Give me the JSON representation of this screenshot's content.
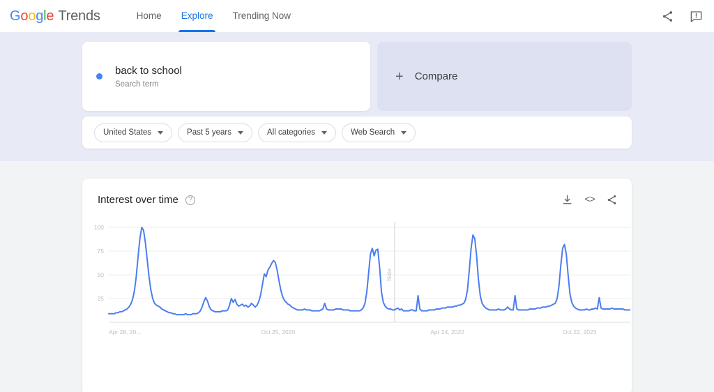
{
  "header": {
    "logo": {
      "text": "Google",
      "suffix": "Trends"
    },
    "nav": [
      {
        "label": "Home",
        "active": false
      },
      {
        "label": "Explore",
        "active": true
      },
      {
        "label": "Trending Now",
        "active": false
      }
    ],
    "actions": [
      {
        "name": "share-icon"
      },
      {
        "name": "feedback-icon"
      }
    ]
  },
  "query": {
    "term": "back to school",
    "type": "Search term",
    "dot_color": "#4285F4",
    "compare_label": "Compare",
    "compare_plus": "+"
  },
  "filters": [
    {
      "label": "United States",
      "name": "location"
    },
    {
      "label": "Past 5 years",
      "name": "time-range"
    },
    {
      "label": "All categories",
      "name": "category"
    },
    {
      "label": "Web Search",
      "name": "search-type"
    }
  ],
  "chart_card": {
    "title": "Interest over time",
    "help_glyph": "?",
    "tools": [
      {
        "name": "download-icon"
      },
      {
        "name": "embed-icon",
        "glyph": "<>"
      },
      {
        "name": "share-icon"
      }
    ]
  },
  "chart_data": {
    "type": "line",
    "title": "Interest over time",
    "xlabel": "",
    "ylabel": "",
    "ylim": [
      0,
      100
    ],
    "grid": true,
    "legend": false,
    "line_color": "#4C7DF0",
    "series_name": "back to school",
    "ytick_labels": [
      "100",
      "75",
      "50",
      "25"
    ],
    "yticks": [
      100,
      75,
      50,
      25
    ],
    "xtick_labels": [
      "Apr 28, 20...",
      "Oct 25, 2020",
      "Apr 24, 2022",
      "Oct 22, 2023"
    ],
    "xtick_positions": [
      0,
      0.3246,
      0.6492,
      0.9026
    ],
    "annotations": [
      {
        "text": "Note",
        "type": "vertical-line",
        "x_fraction": 0.5481
      }
    ],
    "values": [
      9,
      9,
      9,
      9,
      10,
      10,
      11,
      11,
      12,
      13,
      14,
      16,
      19,
      24,
      33,
      48,
      69,
      88,
      100,
      97,
      84,
      66,
      48,
      34,
      25,
      20,
      18,
      17,
      16,
      14,
      13,
      12,
      11,
      10,
      10,
      9,
      9,
      8,
      8,
      8,
      8,
      8,
      9,
      8,
      8,
      8,
      9,
      9,
      9,
      10,
      12,
      16,
      22,
      26,
      22,
      16,
      13,
      12,
      11,
      11,
      11,
      11,
      12,
      12,
      12,
      13,
      18,
      25,
      21,
      24,
      19,
      17,
      18,
      19,
      17,
      18,
      16,
      17,
      20,
      18,
      16,
      18,
      22,
      29,
      40,
      51,
      48,
      55,
      58,
      62,
      65,
      63,
      55,
      44,
      34,
      27,
      23,
      21,
      19,
      18,
      16,
      15,
      14,
      13,
      13,
      13,
      13,
      14,
      13,
      13,
      13,
      12,
      12,
      12,
      12,
      12,
      13,
      14,
      20,
      14,
      13,
      13,
      13,
      13,
      14,
      14,
      14,
      14,
      13,
      13,
      13,
      13,
      12,
      12,
      12,
      12,
      12,
      12,
      13,
      15,
      20,
      32,
      52,
      72,
      78,
      70,
      76,
      77,
      58,
      32,
      21,
      17,
      15,
      14,
      14,
      13,
      13,
      14,
      15,
      13,
      14,
      12,
      12,
      12,
      12,
      13,
      13,
      12,
      12,
      28,
      14,
      12,
      12,
      12,
      12,
      13,
      13,
      13,
      13,
      14,
      14,
      14,
      15,
      15,
      15,
      16,
      16,
      16,
      16,
      17,
      17,
      18,
      18,
      19,
      20,
      24,
      34,
      55,
      78,
      92,
      88,
      70,
      45,
      28,
      20,
      17,
      15,
      14,
      13,
      13,
      13,
      13,
      13,
      14,
      13,
      13,
      13,
      14,
      16,
      14,
      13,
      13,
      28,
      14,
      13,
      13,
      13,
      13,
      13,
      13,
      14,
      14,
      14,
      14,
      15,
      15,
      15,
      16,
      16,
      16,
      17,
      17,
      18,
      19,
      20,
      25,
      38,
      60,
      78,
      82,
      72,
      50,
      30,
      21,
      17,
      15,
      14,
      13,
      13,
      13,
      13,
      14,
      13,
      13,
      14,
      14,
      15,
      14,
      26,
      15,
      14,
      14,
      14,
      14,
      14,
      15,
      14,
      14,
      14,
      14,
      14,
      14,
      13,
      13,
      13,
      13
    ]
  }
}
